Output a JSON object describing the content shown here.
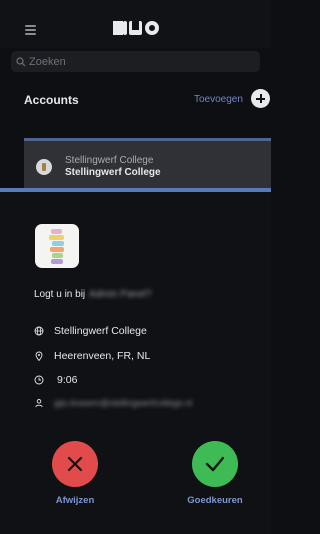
{
  "header": {
    "logo_text": "DUO"
  },
  "search": {
    "placeholder": "Zoeken"
  },
  "accounts": {
    "title": "Accounts",
    "add_label": "Toevoegen",
    "items": [
      {
        "name": "Stellingwerf College",
        "subtitle": "Stellingwerf College"
      }
    ]
  },
  "request": {
    "question_prefix": "Logt u in bij",
    "app_name_blurred": "Admin Panel?",
    "organization": "Stellingwerf College",
    "location": "Heerenveen, FR, NL",
    "time": "9:06",
    "user_email_blurred": "gijs.brasem@stellingwerfcollege.nl"
  },
  "actions": {
    "deny_label": "Afwijzen",
    "approve_label": "Goedkeuren"
  },
  "colors": {
    "background": "#0e0f12",
    "accent": "#587ab8",
    "deny": "#e14b4c",
    "approve": "#3fbb55"
  }
}
